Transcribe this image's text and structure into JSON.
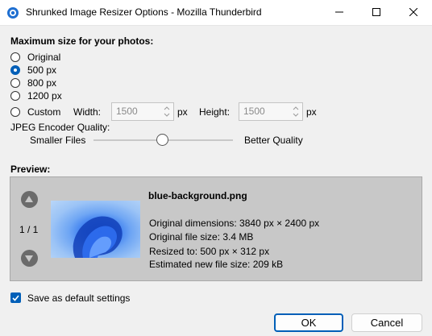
{
  "window": {
    "title": "Shrunked Image Resizer Options - Mozilla Thunderbird",
    "icons": [
      "app-icon",
      "minimize-icon",
      "maximize-icon",
      "close-icon"
    ]
  },
  "size_section": {
    "heading": "Maximum size for your photos:",
    "options": [
      "Original",
      "500 px",
      "800 px",
      "1200 px",
      "Custom"
    ],
    "selected": "500 px",
    "width_label": "Width:",
    "width_value": "1500",
    "width_unit": "px",
    "height_label": "Height:",
    "height_value": "1500",
    "height_unit": "px"
  },
  "quality": {
    "label": "JPEG Encoder Quality:",
    "left_label": "Smaller Files",
    "right_label": "Better Quality",
    "level_fraction": 0.5
  },
  "preview": {
    "heading": "Preview:",
    "counter": "1 / 1",
    "filename": "blue-background.png",
    "original_dimensions": "Original dimensions: 3840 px × 2400 px",
    "original_size": "Original file size: 3.4 MB",
    "resized_to": "Resized to: 500 px × 312 px",
    "estimated_size": "Estimated new file size: 209 kB"
  },
  "save_default": {
    "label": "Save as default settings",
    "checked": true
  },
  "buttons": {
    "ok": "OK",
    "cancel": "Cancel"
  },
  "colors": {
    "accent": "#005fb8",
    "preview_bg": "#c8c8c8"
  }
}
